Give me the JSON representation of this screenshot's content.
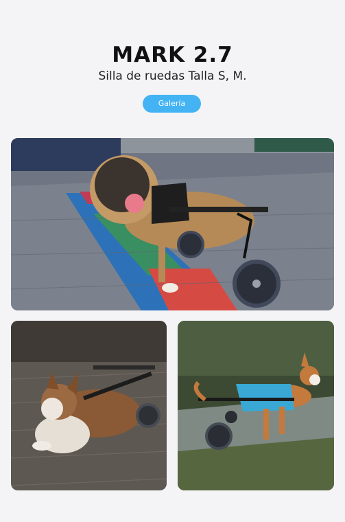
{
  "product": {
    "title": "MARK 2.7",
    "subtitle": "Silla de ruedas Talla S, M."
  },
  "gallery_button": {
    "label": "Galería"
  },
  "photos": [
    {
      "subject": "pug-in-wheelchair"
    },
    {
      "subject": "corgi-in-wheelchair"
    },
    {
      "subject": "dog-in-wheelchair-with-blue-coat"
    }
  ],
  "colors": {
    "accent": "#43b3f4",
    "background": "#f4f4f7",
    "title": "#111111"
  }
}
